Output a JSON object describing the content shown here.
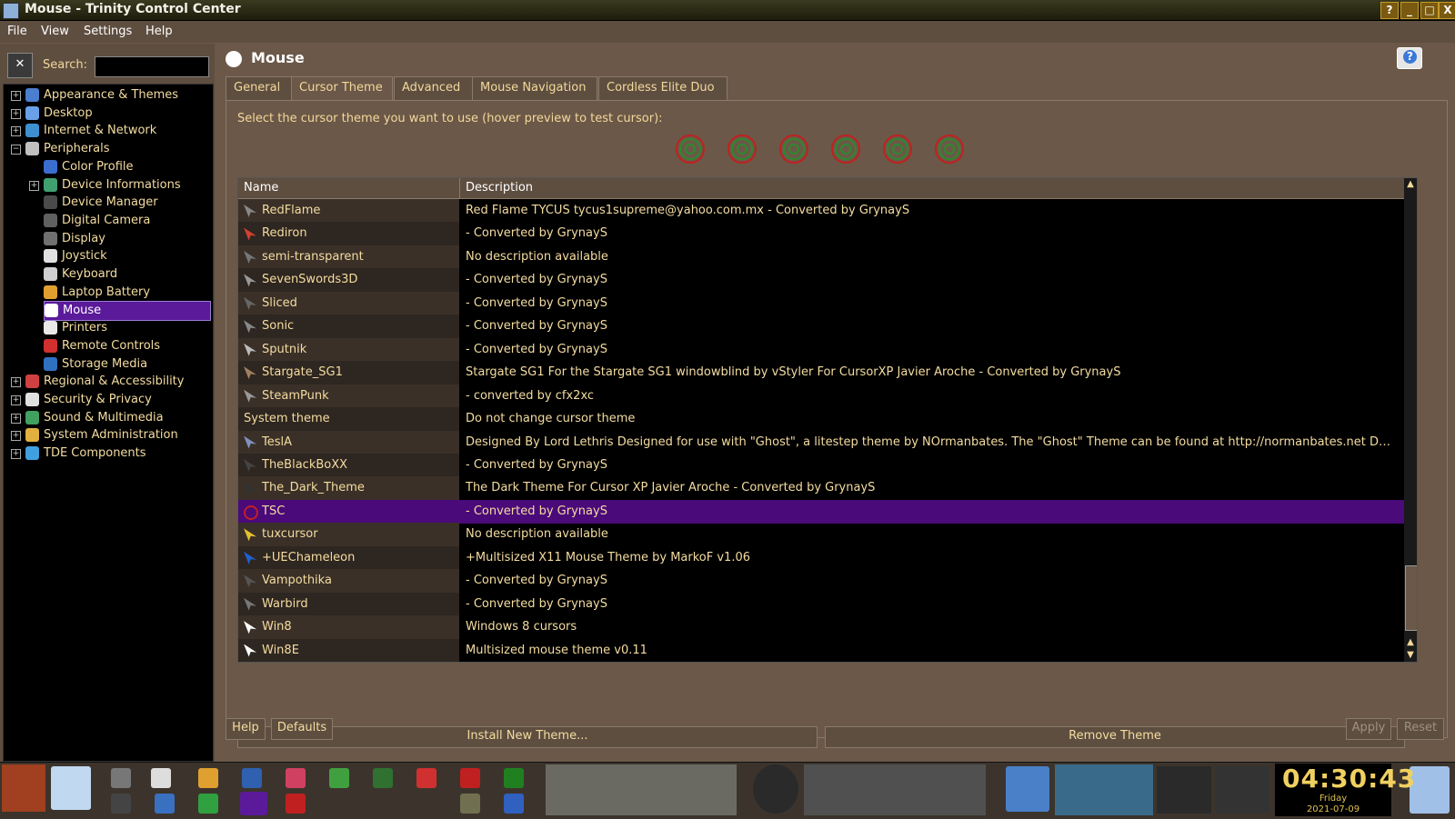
{
  "window": {
    "title": "Mouse - Trinity Control Center",
    "buttons": [
      "?",
      "_",
      "□",
      "X"
    ]
  },
  "menubar": {
    "items": [
      "File",
      "View",
      "Settings",
      "Help"
    ]
  },
  "sidebar": {
    "search_label": "Search:",
    "search_value": "",
    "tree": [
      {
        "label": "Appearance & Themes",
        "level": 0,
        "icon": "appearance-icon",
        "color": "#4a7fd0"
      },
      {
        "label": "Desktop",
        "level": 0,
        "icon": "desktop-icon",
        "color": "#6aa0e8"
      },
      {
        "label": "Internet & Network",
        "level": 0,
        "icon": "network-icon",
        "color": "#3d8fd0"
      },
      {
        "label": "Peripherals",
        "level": 0,
        "icon": "peripherals-icon",
        "color": "#c0c0c0"
      },
      {
        "label": "Color Profile",
        "level": 1,
        "icon": "color-profile-icon",
        "color": "#3a6fd0"
      },
      {
        "label": "Device Informations",
        "level": 1,
        "icon": "device-info-icon",
        "color": "#40a070"
      },
      {
        "label": "Device Manager",
        "level": 1,
        "icon": "device-manager-icon",
        "color": "#4a4a4a"
      },
      {
        "label": "Digital Camera",
        "level": 1,
        "icon": "camera-icon",
        "color": "#606060"
      },
      {
        "label": "Display",
        "level": 1,
        "icon": "display-icon",
        "color": "#707070"
      },
      {
        "label": "Joystick",
        "level": 1,
        "icon": "joystick-icon",
        "color": "#e0e0e0"
      },
      {
        "label": "Keyboard",
        "level": 1,
        "icon": "keyboard-icon",
        "color": "#d0d0d0"
      },
      {
        "label": "Laptop Battery",
        "level": 1,
        "icon": "battery-icon",
        "color": "#e0a030"
      },
      {
        "label": "Mouse",
        "level": 1,
        "icon": "mouse-icon",
        "color": "#ffffff",
        "selected": true
      },
      {
        "label": "Printers",
        "level": 1,
        "icon": "printer-icon",
        "color": "#e8e8e8"
      },
      {
        "label": "Remote Controls",
        "level": 1,
        "icon": "remote-icon",
        "color": "#d03030"
      },
      {
        "label": "Storage Media",
        "level": 1,
        "icon": "storage-icon",
        "color": "#3070c0"
      },
      {
        "label": "Regional & Accessibility",
        "level": 0,
        "icon": "regional-icon",
        "color": "#d04040"
      },
      {
        "label": "Security & Privacy",
        "level": 0,
        "icon": "security-icon",
        "color": "#e0e0e0"
      },
      {
        "label": "Sound & Multimedia",
        "level": 0,
        "icon": "sound-icon",
        "color": "#40a060"
      },
      {
        "label": "System Administration",
        "level": 0,
        "icon": "sysadmin-icon",
        "color": "#e0b040"
      },
      {
        "label": "TDE Components",
        "level": 0,
        "icon": "tde-components-icon",
        "color": "#40a0e0"
      }
    ]
  },
  "page": {
    "title": "Mouse"
  },
  "tabs": [
    "General",
    "Cursor Theme",
    "Advanced",
    "Mouse Navigation",
    "Cordless Elite Duo"
  ],
  "active_tab": 1,
  "prompt": "Select the cursor theme you want to use (hover preview to test cursor):",
  "list": {
    "headers": {
      "name": "Name",
      "description": "Description"
    },
    "rows": [
      {
        "name": "RedFlame",
        "desc": "Red Flame TYCUS tycus1supreme@yahoo.com.mx - Converted by GrynayS",
        "icon": "cursor-arrow-icon",
        "color": "#888888"
      },
      {
        "name": "Rediron",
        "desc": "- Converted by GrynayS",
        "icon": "cursor-arrow-icon",
        "color": "#d04030"
      },
      {
        "name": "semi-transparent",
        "desc": "No description available",
        "icon": "cursor-arrow-icon",
        "color": "#777777"
      },
      {
        "name": "SevenSwords3D",
        "desc": "- Converted by GrynayS",
        "icon": "cursor-arrow-icon",
        "color": "#999999"
      },
      {
        "name": "Sliced",
        "desc": "- Converted by GrynayS",
        "icon": "cursor-arrow-icon",
        "color": "#666666"
      },
      {
        "name": "Sonic",
        "desc": "- Converted by GrynayS",
        "icon": "cursor-arrow-icon",
        "color": "#888888"
      },
      {
        "name": "Sputnik",
        "desc": "- Converted by GrynayS",
        "icon": "cursor-arrow-icon",
        "color": "#bbbbbb"
      },
      {
        "name": "Stargate_SG1",
        "desc": "Stargate SG1 For the Stargate SG1 windowblind by vStyler For CursorXP Javier Aroche - Converted by GrynayS",
        "icon": "cursor-arrow-icon",
        "color": "#a08060"
      },
      {
        "name": "SteamPunk",
        "desc": "- converted by cfx2xc",
        "icon": "cursor-arrow-icon",
        "color": "#999999"
      },
      {
        "name": "System theme",
        "desc": "Do not change cursor theme",
        "icon": "",
        "color": "",
        "system": true
      },
      {
        "name": "TeslA",
        "desc": "Designed By Lord Lethris Designed for use with \"Ghost\", a litestep theme by NOrmanbates.  The \"Ghost\" Theme can be found at http://normanbates.net Don'...",
        "icon": "cursor-arrow-icon",
        "color": "#8090c0"
      },
      {
        "name": "TheBlackBoXX",
        "desc": "- Converted by GrynayS",
        "icon": "cursor-arrow-icon",
        "color": "#444444"
      },
      {
        "name": "The_Dark_Theme",
        "desc": "The Dark Theme For Cursor XP Javier Aroche - Converted by GrynayS",
        "icon": "cursor-arrow-icon",
        "color": "#333333"
      },
      {
        "name": "TSC",
        "desc": "- Converted by GrynayS",
        "icon": "tsc-target-icon",
        "color": "#c02020",
        "selected": true
      },
      {
        "name": "tuxcursor",
        "desc": "No description available",
        "icon": "tux-icon",
        "color": "#e0c030"
      },
      {
        "name": "+UEChameleon",
        "desc": "+Multisized X11 Mouse Theme by MarkoF v1.06",
        "icon": "cursor-arrow-icon",
        "color": "#2060d0"
      },
      {
        "name": "Vampothika",
        "desc": "- Converted by GrynayS",
        "icon": "cursor-arrow-icon",
        "color": "#555555"
      },
      {
        "name": "Warbird",
        "desc": "- Converted by GrynayS",
        "icon": "cursor-arrow-icon",
        "color": "#777777"
      },
      {
        "name": "Win8",
        "desc": "Windows 8 cursors",
        "icon": "cursor-arrow-icon",
        "color": "#ffffff"
      },
      {
        "name": "Win8E",
        "desc": "Multisized mouse theme v0.11",
        "icon": "cursor-arrow-icon",
        "color": "#ffffff"
      }
    ]
  },
  "buttons": {
    "install": "Install New Theme...",
    "remove": "Remove Theme",
    "help": "Help",
    "defaults": "Defaults",
    "apply": "Apply",
    "reset": "Reset"
  },
  "clock": {
    "time": "04:30:43",
    "day": "Friday",
    "date": "2021-07-09"
  },
  "colors": {
    "accent": "#f3d89b",
    "selection": "#4a0a7a",
    "background": "#6b5848"
  }
}
